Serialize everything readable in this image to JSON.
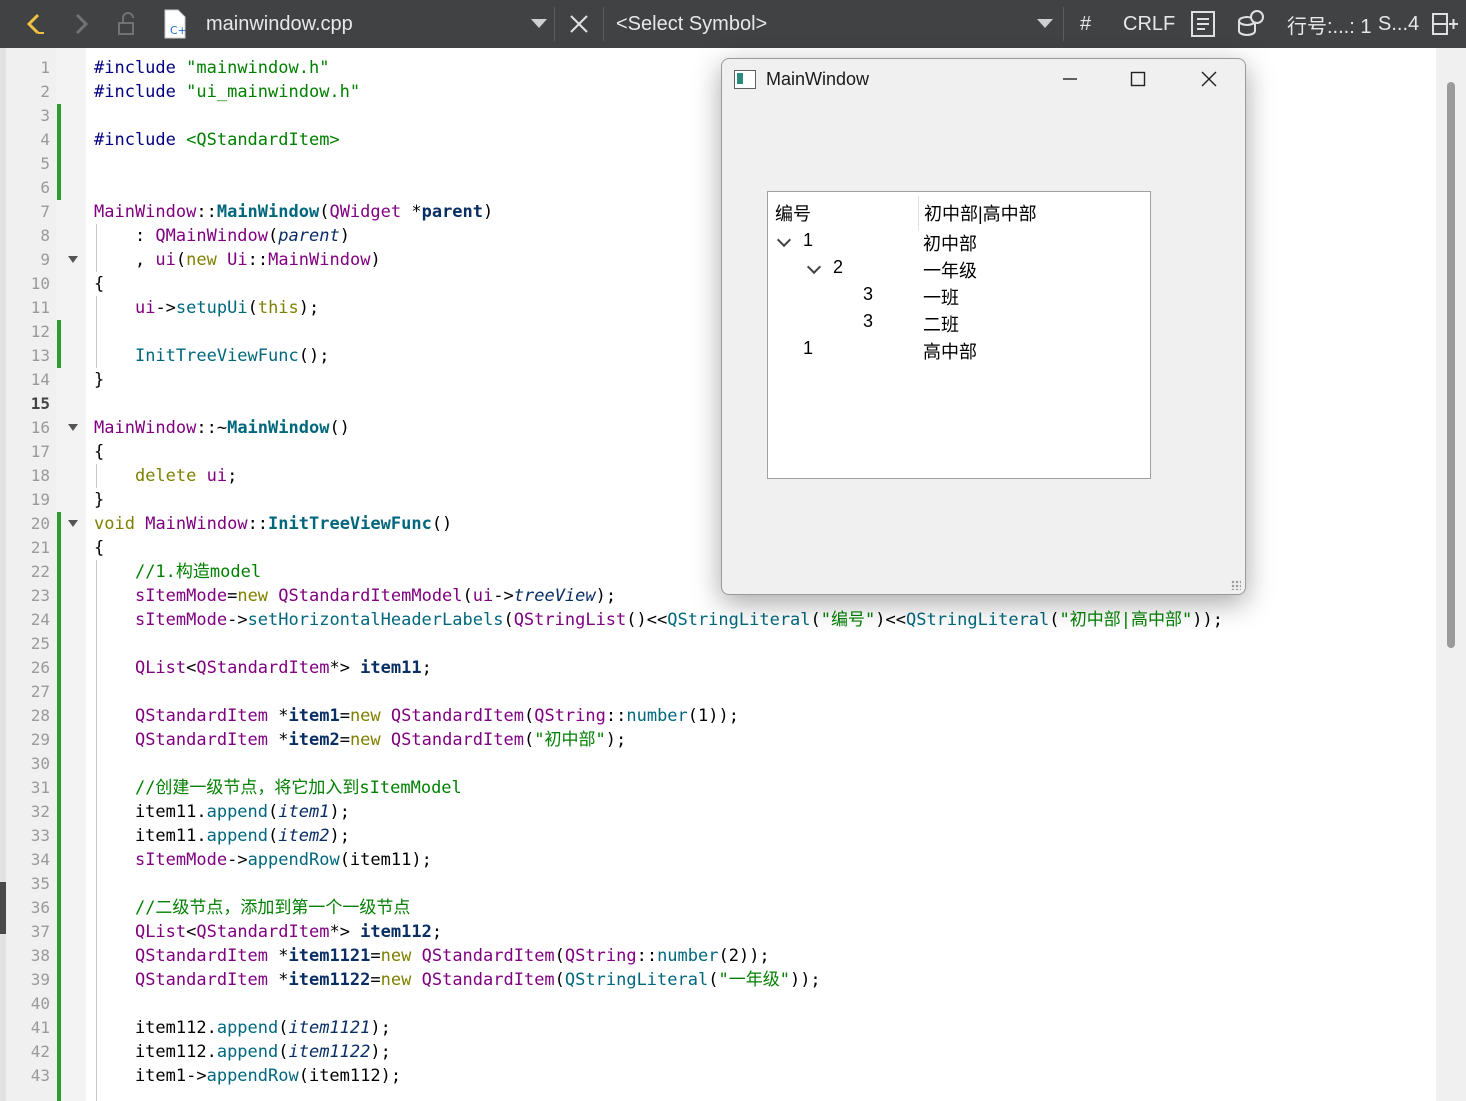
{
  "toolbar": {
    "file_name": "mainwindow.cpp",
    "symbol_placeholder": "<Select Symbol>",
    "hash_label": "#",
    "line_ending": "CRLF",
    "position_label": "行号:...: 1",
    "split_label": "S...4",
    "icons": [
      "back-arrow-icon",
      "forward-arrow-icon",
      "lock-icon",
      "cpp-file-icon",
      "dropdown-icon",
      "close-icon",
      "outline-icon",
      "database-icon",
      "split-icon"
    ]
  },
  "editor": {
    "current_line": 15,
    "lines": [
      {
        "n": "1",
        "html": "<span class=\"pp\">#include</span> <span class=\"str\">\"mainwindow.h\"</span>"
      },
      {
        "n": "2",
        "html": "<span class=\"pp\">#include</span> <span class=\"str\">\"ui_mainwindow.h\"</span>"
      },
      {
        "n": "3",
        "html": ""
      },
      {
        "n": "4",
        "html": "<span class=\"pp\">#include</span> <span class=\"str\">&lt;QStandardItem&gt;</span>"
      },
      {
        "n": "5",
        "html": ""
      },
      {
        "n": "6",
        "html": ""
      },
      {
        "n": "7",
        "html": "<span class=\"ty\">MainWindow</span>::<span class=\"fnb\">MainWindow</span>(<span class=\"ty\">QWidget</span> *<span class=\"bd\">parent</span>)"
      },
      {
        "n": "8",
        "html": "    : <span class=\"ty\">QMainWindow</span>(<span class=\"it\">parent</span>)"
      },
      {
        "n": "9",
        "html": "    , <span class=\"ty\">ui</span>(<span class=\"kw\">new</span> <span class=\"ty\">Ui</span>::<span class=\"ty\">MainWindow</span>)"
      },
      {
        "n": "10",
        "html": "{"
      },
      {
        "n": "11",
        "html": "    <span class=\"ty\">ui</span>-&gt;<span class=\"fn\">setupUi</span>(<span class=\"kw\">this</span>);"
      },
      {
        "n": "12",
        "html": ""
      },
      {
        "n": "13",
        "html": "    <span class=\"fn\">InitTreeViewFunc</span>();"
      },
      {
        "n": "14",
        "html": "}"
      },
      {
        "n": "15",
        "html": ""
      },
      {
        "n": "16",
        "html": "<span class=\"ty\">MainWindow</span>::~<span class=\"fnb\">MainWindow</span>()"
      },
      {
        "n": "17",
        "html": "{"
      },
      {
        "n": "18",
        "html": "    <span class=\"kw\">delete</span> <span class=\"ty\">ui</span>;"
      },
      {
        "n": "19",
        "html": "}"
      },
      {
        "n": "20",
        "html": "<span class=\"kw\">void</span> <span class=\"ty\">MainWindow</span>::<span class=\"fnb\">InitTreeViewFunc</span>()"
      },
      {
        "n": "21",
        "html": "{"
      },
      {
        "n": "22",
        "html": "    <span class=\"cm\">//1.构造model</span>"
      },
      {
        "n": "23",
        "html": "    <span class=\"ty\">sItemMode</span>=<span class=\"kw\">new</span> <span class=\"ty\">QStandardItemModel</span>(<span class=\"ty\">ui</span>-&gt;<span class=\"it\">treeView</span>);"
      },
      {
        "n": "24",
        "html": "    <span class=\"ty\">sItemMode</span>-&gt;<span class=\"fn\">setHorizontalHeaderLabels</span>(<span class=\"ty\">QStringList</span>()&lt;&lt;<span class=\"fn\">QStringLiteral</span>(<span class=\"str\">\"编号\"</span>)&lt;&lt;<span class=\"fn\">QStringLiteral</span>(<span class=\"str\">\"初中部|高中部\"</span>));"
      },
      {
        "n": "25",
        "html": ""
      },
      {
        "n": "26",
        "html": "    <span class=\"ty\">QList</span>&lt;<span class=\"ty\">QStandardItem</span>*&gt; <span class=\"bd\">item11</span>;"
      },
      {
        "n": "27",
        "html": ""
      },
      {
        "n": "28",
        "html": "    <span class=\"ty\">QStandardItem</span> *<span class=\"bd\">item1</span>=<span class=\"kw\">new</span> <span class=\"ty\">QStandardItem</span>(<span class=\"ty\">QString</span>::<span class=\"fn\">number</span>(1));"
      },
      {
        "n": "29",
        "html": "    <span class=\"ty\">QStandardItem</span> *<span class=\"bd\">item2</span>=<span class=\"kw\">new</span> <span class=\"ty\">QStandardItem</span>(<span class=\"str\">\"初中部\"</span>);"
      },
      {
        "n": "30",
        "html": ""
      },
      {
        "n": "31",
        "html": "    <span class=\"cm\">//创建一级节点，将它加入到sItemModel</span>"
      },
      {
        "n": "32",
        "html": "    item11.<span class=\"fn\">append</span>(<span class=\"it\">item1</span>);"
      },
      {
        "n": "33",
        "html": "    item11.<span class=\"fn\">append</span>(<span class=\"it\">item2</span>);"
      },
      {
        "n": "34",
        "html": "    <span class=\"ty\">sItemMode</span>-&gt;<span class=\"fn\">appendRow</span>(item11);"
      },
      {
        "n": "35",
        "html": ""
      },
      {
        "n": "36",
        "html": "    <span class=\"cm\">//二级节点，添加到第一个一级节点</span>"
      },
      {
        "n": "37",
        "html": "    <span class=\"ty\">QList</span>&lt;<span class=\"ty\">QStandardItem</span>*&gt; <span class=\"bd\">item112</span>;"
      },
      {
        "n": "38",
        "html": "    <span class=\"ty\">QStandardItem</span> *<span class=\"bd\">item1121</span>=<span class=\"kw\">new</span> <span class=\"ty\">QStandardItem</span>(<span class=\"ty\">QString</span>::<span class=\"fn\">number</span>(2));"
      },
      {
        "n": "39",
        "html": "    <span class=\"ty\">QStandardItem</span> *<span class=\"bd\">item1122</span>=<span class=\"kw\">new</span> <span class=\"ty\">QStandardItem</span>(<span class=\"fn\">QStringLiteral</span>(<span class=\"str\">\"一年级\"</span>));"
      },
      {
        "n": "40",
        "html": ""
      },
      {
        "n": "41",
        "html": "    item112.<span class=\"fn\">append</span>(<span class=\"it\">item1121</span>);"
      },
      {
        "n": "42",
        "html": "    item112.<span class=\"fn\">append</span>(<span class=\"it\">item1122</span>);"
      },
      {
        "n": "43",
        "html": "    item1-&gt;<span class=\"fn\">appendRow</span>(item112);"
      }
    ],
    "fold_lines": [
      9,
      16,
      20
    ]
  },
  "mainwindow": {
    "title": "MainWindow",
    "headers": [
      "编号",
      "初中部|高中部"
    ],
    "rows": [
      {
        "id": "1",
        "name": "初中部",
        "level": 0,
        "expanded": true
      },
      {
        "id": "2",
        "name": "一年级",
        "level": 1,
        "expanded": true
      },
      {
        "id": "3",
        "name": "一班",
        "level": 2,
        "expanded": null
      },
      {
        "id": "3",
        "name": "二班",
        "level": 2,
        "expanded": null
      },
      {
        "id": "1",
        "name": "高中部",
        "level": 0,
        "expanded": null
      }
    ]
  },
  "colors": {
    "toolbar_bg": "#404244",
    "change_bar": "#2d9e2d",
    "keyword": "#808000",
    "type": "#800080",
    "string": "#008000",
    "function": "#00677c"
  }
}
